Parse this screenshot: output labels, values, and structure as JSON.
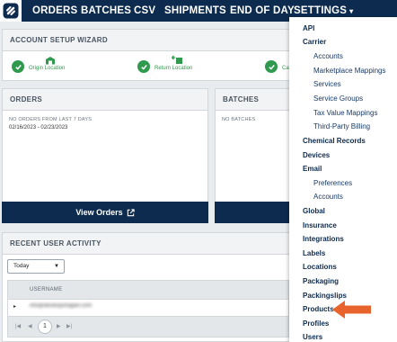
{
  "nav": {
    "items": [
      "ORDERS",
      "BATCHES",
      "CSV",
      "SHIPMENTS",
      "END OF DAY",
      "SETTINGS"
    ],
    "settings_caret": "▾"
  },
  "wizard": {
    "title": "ACCOUNT SETUP WIZARD",
    "steps": [
      "Origin Location",
      "Return Location",
      "Ca"
    ]
  },
  "orders": {
    "title": "ORDERS",
    "empty_text": "NO ORDERS FROM LAST 7 DAYS",
    "date_range": "02/16/2023 - 02/23/2023",
    "view_button": "View Orders"
  },
  "batches": {
    "title": "BATCHES",
    "empty_text": "NO BATCHES"
  },
  "activity": {
    "title": "RECENT USER ACTIVITY",
    "range_select": "Today",
    "column_username": "USERNAME",
    "row_username": "info@desktopshipper.com",
    "page_number": "1"
  },
  "settings_menu": {
    "api": "API",
    "carrier": "Carrier",
    "carrier_accounts": "Accounts",
    "carrier_marketplace": "Marketplace Mappings",
    "carrier_services": "Services",
    "carrier_service_groups": "Service Groups",
    "carrier_tax": "Tax Value Mappings",
    "carrier_third_party": "Third-Party Billing",
    "chemical": "Chemical Records",
    "devices": "Devices",
    "email": "Email",
    "email_preferences": "Preferences",
    "email_accounts": "Accounts",
    "global": "Global",
    "insurance": "Insurance",
    "integrations": "Integrations",
    "labels": "Labels",
    "locations": "Locations",
    "packaging": "Packaging",
    "packingslips": "Packingslips",
    "products": "Products",
    "profiles": "Profiles",
    "users": "Users"
  },
  "colors": {
    "nav_bg": "#0d2b4e",
    "success_green": "#2f9a4d",
    "highlight_arrow": "#e8642c"
  }
}
